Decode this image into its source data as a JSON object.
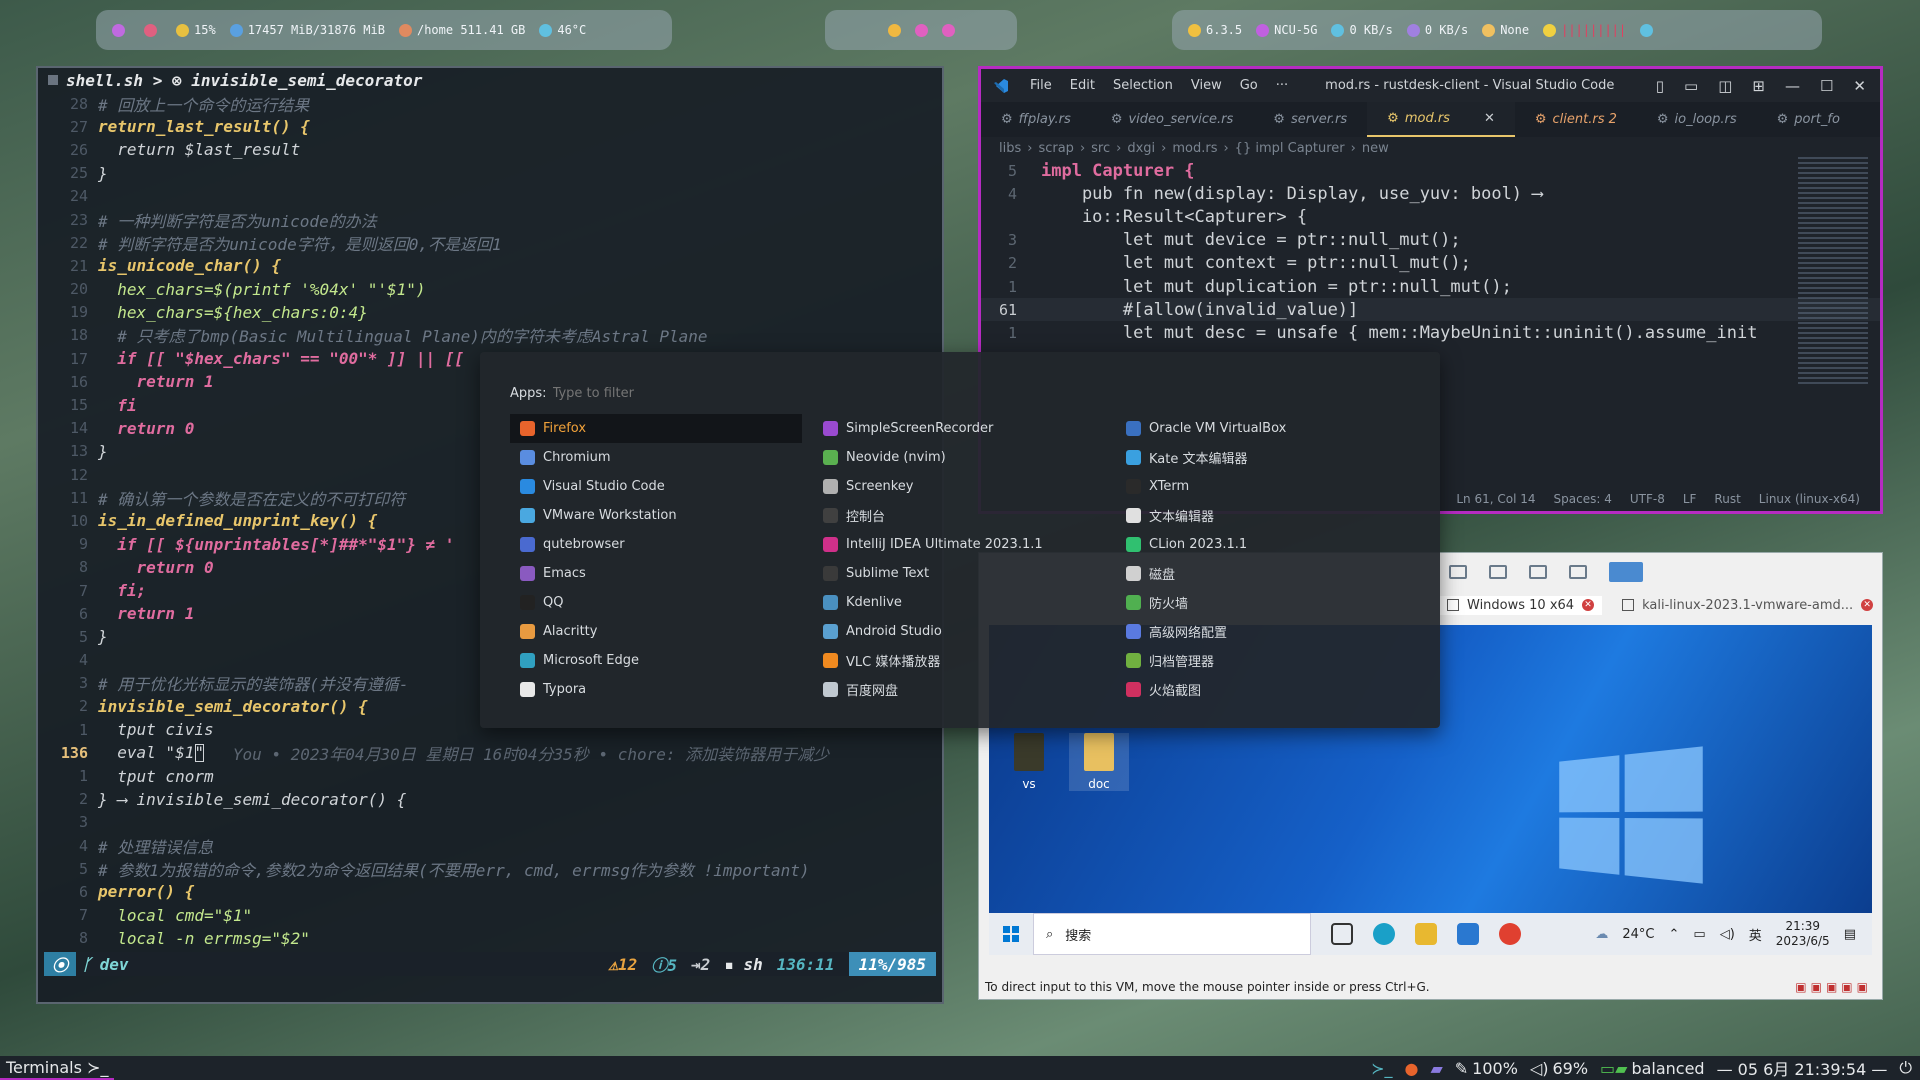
{
  "topbar": {
    "left": [
      {
        "icon": "arch-icon",
        "text": ""
      },
      {
        "icon": "pacman-icon",
        "text": ""
      },
      {
        "icon": "cpu-icon",
        "text": "15%"
      },
      {
        "icon": "memory-icon",
        "text": "17457 MiB/31876 MiB"
      },
      {
        "icon": "disk-icon",
        "text": "/home 511.41 GB"
      },
      {
        "icon": "temperature-icon",
        "text": "46°C"
      }
    ],
    "center": [
      {
        "icon": "moon-icon"
      },
      {
        "icon": "workspace-dot-icon"
      },
      {
        "icon": "workspace-dot-icon"
      }
    ],
    "right": [
      {
        "icon": "kernel-icon",
        "text": "6.3.5"
      },
      {
        "icon": "wifi-icon",
        "text": "NCU-5G"
      },
      {
        "icon": "upload-icon",
        "text": "0 KB/s"
      },
      {
        "icon": "download-icon",
        "text": "0 KB/s"
      },
      {
        "icon": "package-icon",
        "text": "None"
      },
      {
        "icon": "brightness-icon",
        "text": "|||||||||"
      },
      {
        "icon": "power-icon",
        "text": ""
      }
    ]
  },
  "terminal": {
    "title": "shell.sh > ⊗ invisible_semi_decorator",
    "lines": [
      {
        "ln": "28",
        "type": "comment",
        "text": "# 回放上一个命令的运行结果"
      },
      {
        "ln": "27",
        "type": "fn",
        "text": "return_last_result() {"
      },
      {
        "ln": "26",
        "type": "code",
        "text": "  return $last_result"
      },
      {
        "ln": "25",
        "type": "code",
        "text": "}"
      },
      {
        "ln": "24",
        "type": "code",
        "text": ""
      },
      {
        "ln": "23",
        "type": "comment",
        "text": "# 一种判断字符是否为unicode的办法"
      },
      {
        "ln": "22",
        "type": "comment",
        "text": "# 判断字符是否为unicode字符，是则返回0,不是返回1"
      },
      {
        "ln": "21",
        "type": "fn",
        "text": "is_unicode_char() {"
      },
      {
        "ln": "20",
        "type": "var",
        "text": "  hex_chars=$(printf '%04x' \"'$1\")"
      },
      {
        "ln": "19",
        "type": "var",
        "text": "  hex_chars=${hex_chars:0:4}"
      },
      {
        "ln": "18",
        "type": "comment",
        "text": "  # 只考虑了bmp(Basic Multilingual Plane)内的字符未考虑Astral Plane"
      },
      {
        "ln": "17",
        "type": "kw",
        "text": "  if [[ \"$hex_chars\" == \"00\"* ]] || [["
      },
      {
        "ln": "16",
        "type": "kw",
        "text": "    return 1"
      },
      {
        "ln": "15",
        "type": "kw",
        "text": "  fi"
      },
      {
        "ln": "14",
        "type": "kw",
        "text": "  return 0"
      },
      {
        "ln": "13",
        "type": "code",
        "text": "}"
      },
      {
        "ln": "12",
        "type": "code",
        "text": ""
      },
      {
        "ln": "11",
        "type": "comment",
        "text": "# 确认第一个参数是否在定义的不可打印符"
      },
      {
        "ln": "10",
        "type": "fn",
        "text": "is_in_defined_unprint_key() {"
      },
      {
        "ln": "9",
        "type": "kw",
        "text": "  if [[ ${unprintables[*]##*\"$1\"} ≠ '"
      },
      {
        "ln": "8",
        "type": "kw",
        "text": "    return 0"
      },
      {
        "ln": "7",
        "type": "kw",
        "text": "  fi;"
      },
      {
        "ln": "6",
        "type": "kw",
        "text": "  return 1"
      },
      {
        "ln": "5",
        "type": "code",
        "text": "}"
      },
      {
        "ln": "4",
        "type": "code",
        "text": ""
      },
      {
        "ln": "3",
        "type": "comment",
        "text": "# 用于优化光标显示的装饰器(并没有遵循-"
      },
      {
        "ln": "2",
        "type": "fn",
        "text": "invisible_semi_decorator() {"
      },
      {
        "ln": "1",
        "type": "code",
        "text": "  tput civis"
      },
      {
        "ln": "136",
        "type": "current",
        "text": "  eval \"$1\"",
        "blame": "   You • 2023年04月30日 星期日 16时04分35秒 • chore: 添加装饰器用于减少"
      },
      {
        "ln": "1",
        "type": "code",
        "text": "  tput cnorm"
      },
      {
        "ln": "2",
        "type": "code",
        "text": "} ⟶ invisible_semi_decorator() {"
      },
      {
        "ln": "3",
        "type": "code",
        "text": ""
      },
      {
        "ln": "4",
        "type": "comment",
        "text": "# 处理错误信息"
      },
      {
        "ln": "5",
        "type": "comment",
        "text": "# 参数1为报错的命令,参数2为命令返回结果(不要用err, cmd, errmsg作为参数 !important)"
      },
      {
        "ln": "6",
        "type": "fn",
        "text": "perror() {"
      },
      {
        "ln": "7",
        "type": "var",
        "text": "  local cmd=\"$1\""
      },
      {
        "ln": "8",
        "type": "var",
        "text": "  local -n errmsg=\"$2\""
      }
    ],
    "status": {
      "branch": "dev",
      "warnings": "12",
      "infos": "5",
      "hints": "2",
      "filetype": "sh",
      "position": "136:11",
      "percent": "11%/985"
    }
  },
  "vscode": {
    "menu": [
      "File",
      "Edit",
      "Selection",
      "View",
      "Go",
      "···"
    ],
    "title": "mod.rs - rustdesk-client - Visual Studio Code",
    "tabs": [
      {
        "label": "ffplay.rs",
        "state": "normal"
      },
      {
        "label": "video_service.rs",
        "state": "normal"
      },
      {
        "label": "server.rs",
        "state": "normal"
      },
      {
        "label": "mod.rs",
        "state": "active"
      },
      {
        "label": "client.rs 2",
        "state": "err"
      },
      {
        "label": "io_loop.rs",
        "state": "normal"
      },
      {
        "label": "port_fo",
        "state": "normal"
      }
    ],
    "breadcrumb": [
      "libs",
      "scrap",
      "src",
      "dxgi",
      "mod.rs",
      "{} impl Capturer",
      "new"
    ],
    "code": [
      {
        "ln": "5",
        "text": "impl Capturer {"
      },
      {
        "ln": "4",
        "text": "    pub fn new(display: Display, use_yuv: bool) ⟶"
      },
      {
        "ln": "",
        "text": "    io::Result<Capturer> {"
      },
      {
        "ln": "3",
        "text": "        let mut device = ptr::null_mut();"
      },
      {
        "ln": "2",
        "text": "        let mut context = ptr::null_mut();"
      },
      {
        "ln": "1",
        "text": "        let mut duplication = ptr::null_mut();"
      },
      {
        "ln": "61",
        "text": "        #[allow(invalid_value)]"
      },
      {
        "ln": "1",
        "text": "        let mut desc = unsafe { mem::MaybeUninit::uninit().assume_init"
      }
    ],
    "status": [
      "Ln 61, Col 14",
      "Spaces: 4",
      "UTF-8",
      "LF",
      "Rust",
      "Linux (linux-x64)"
    ]
  },
  "launcher": {
    "label": "Apps:",
    "placeholder": "Type to filter",
    "columns": [
      [
        {
          "name": "Firefox",
          "icon": "firefox-icon",
          "color": "#e8642c"
        },
        {
          "name": "Chromium",
          "icon": "chromium-icon",
          "color": "#5a8de0"
        },
        {
          "name": "Visual Studio Code",
          "icon": "vscode-icon",
          "color": "#2a8ae0"
        },
        {
          "name": "VMware Workstation",
          "icon": "vmware-icon",
          "color": "#4aa8e0"
        },
        {
          "name": "qutebrowser",
          "icon": "qutebrowser-icon",
          "color": "#4a6ad0"
        },
        {
          "name": "Emacs",
          "icon": "emacs-icon",
          "color": "#8a5ac0"
        },
        {
          "name": "QQ",
          "icon": "qq-icon",
          "color": "#222222"
        },
        {
          "name": "Alacritty",
          "icon": "alacritty-icon",
          "color": "#e89a40"
        },
        {
          "name": "Microsoft Edge",
          "icon": "edge-icon",
          "color": "#30a0c0"
        },
        {
          "name": "Typora",
          "icon": "typora-icon",
          "color": "#e8e8e8"
        }
      ],
      [
        {
          "name": "SimpleScreenRecorder",
          "icon": "screenrecorder-icon",
          "color": "#9a4ad0"
        },
        {
          "name": "Neovide (nvim)",
          "icon": "neovide-icon",
          "color": "#5ab050"
        },
        {
          "name": "Screenkey",
          "icon": "keyboard-icon",
          "color": "#b0b0b0"
        },
        {
          "name": "控制台",
          "icon": "console-icon",
          "color": "#404040"
        },
        {
          "name": "IntelliJ IDEA Ultimate 2023.1.1",
          "icon": "intellij-icon",
          "color": "#d0308a"
        },
        {
          "name": "Sublime Text",
          "icon": "sublime-icon",
          "color": "#3a3a3a"
        },
        {
          "name": "Kdenlive",
          "icon": "kdenlive-icon",
          "color": "#4a90c0"
        },
        {
          "name": "Android Studio",
          "icon": "android-studio-icon",
          "color": "#5aa0d0"
        },
        {
          "name": "VLC 媒体播放器",
          "icon": "vlc-icon",
          "color": "#f08a20"
        },
        {
          "name": "百度网盘",
          "icon": "baidu-netdisk-icon",
          "color": "#c0c8d0"
        }
      ],
      [
        {
          "name": "Oracle VM VirtualBox",
          "icon": "virtualbox-icon",
          "color": "#3a70c0"
        },
        {
          "name": "Kate 文本编辑器",
          "icon": "kate-icon",
          "color": "#3aa0e0"
        },
        {
          "name": "XTerm",
          "icon": "xterm-icon",
          "color": "#2a2a2a"
        },
        {
          "name": "文本编辑器",
          "icon": "text-editor-icon",
          "color": "#e0e0e0"
        },
        {
          "name": "CLion 2023.1.1",
          "icon": "clion-icon",
          "color": "#30c070"
        },
        {
          "name": "磁盘",
          "icon": "disks-icon",
          "color": "#d0d0d0"
        },
        {
          "name": "防火墙",
          "icon": "firewall-icon",
          "color": "#50b050"
        },
        {
          "name": "高级网络配置",
          "icon": "network-icon",
          "color": "#5a7ae0"
        },
        {
          "name": "归档管理器",
          "icon": "archive-icon",
          "color": "#70b040"
        },
        {
          "name": "火焰截图",
          "icon": "flameshot-icon",
          "color": "#d03060"
        }
      ]
    ]
  },
  "vmware": {
    "tabs": [
      {
        "label": "Windows 10 x64"
      },
      {
        "label": "kali-linux-2023.1-vmware-amd..."
      }
    ],
    "desktop_icons": [
      "vs",
      "doc"
    ],
    "taskbar": {
      "search": "搜索",
      "weather": "24°C",
      "ime": "英",
      "time": "21:39",
      "date": "2023/6/5"
    },
    "status": "To direct input to this VM, move the mouse pointer inside or press Ctrl+G."
  },
  "bottom_panel": {
    "taskbar_label": "Terminals ≻_",
    "brightness": "100%",
    "volume": "69%",
    "power_profile": "balanced",
    "clock": "— 05 6月 21:39:54 —"
  }
}
